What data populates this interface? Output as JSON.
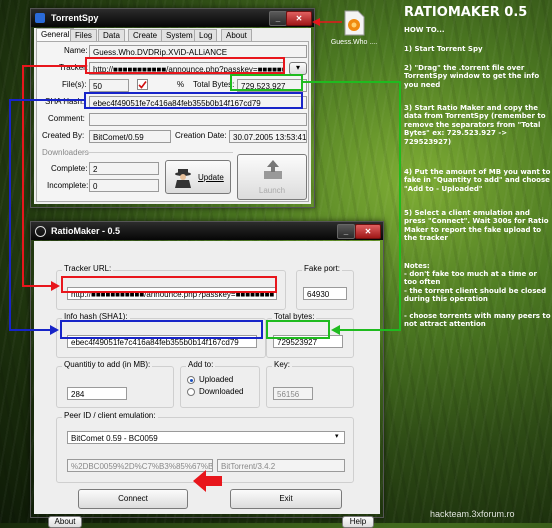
{
  "torrentspy": {
    "title": "TorrentSpy",
    "tabs": [
      "General",
      "Files",
      "Data",
      "Create",
      "System",
      "Log",
      "About"
    ],
    "name_label": "Name:",
    "name_value": "Guess.Who.DVDRip.XViD-ALLiANCE",
    "tracker_label": "Tracker:",
    "tracker_value": "http://■■■■■■■■■■■/announce.php?passkey=■■■■■■■",
    "files_label": "File(s):",
    "files_value": "50",
    "percent_label": "%",
    "total_bytes_label": "Total Bytes:",
    "total_bytes_value": "729.523.927",
    "sha_label": "SHA Hash:",
    "sha_value": "ebec4f49051fe7c416a84feb355b0b14f167cd79",
    "comment_label": "Comment:",
    "created_by_label": "Created By:",
    "created_by_value": "BitComet/0.59",
    "creation_date_label": "Creation Date:",
    "creation_date_value": "30.07.2005 13:53:41",
    "downloaders_label": "Downloaders",
    "complete_label": "Complete:",
    "complete_value": "2",
    "incomplete_label": "Incomplete:",
    "incomplete_value": "0",
    "update_label": "Update",
    "launch_label": "Launch"
  },
  "desktop_icon_label": "Guess.Who ....",
  "ratiomaker": {
    "title": "RatioMaker - 0.5",
    "tracker_url_label": "Tracker URL:",
    "tracker_url_value": "http://■■■■■■■■■■■/announce.php?passkey=■■■■■■■■",
    "fake_port_label": "Fake port:",
    "fake_port_value": "64930",
    "info_hash_label": "Info hash (SHA1):",
    "info_hash_value": "ebec4f49051fe7c416a84feb355b0b14f167cd79",
    "total_bytes_label": "Total bytes:",
    "total_bytes_value": "729523927",
    "quantity_label": "Quantitiy to add (in MB):",
    "quantity_value": "284",
    "add_to_label": "Add to:",
    "uploaded_label": "Uploaded",
    "downloaded_label": "Downloaded",
    "key_label": "Key:",
    "key_value": "56156",
    "peer_label": "Peer ID / client emulation:",
    "client_value": "BitComet 0.59 - BC0059",
    "peer_id_value": "%2DBC0059%2D%C7%B3%85%67%BD%",
    "agent_value": "BitTorrent/3.4.2",
    "connect_label": "Connect",
    "exit_label": "Exit",
    "about_label": "About",
    "help_label": "Help"
  },
  "instructions": {
    "heading": "RATIOMAKER 0.5",
    "howto": "HOW TO...",
    "step1": "1) Start Torrent Spy",
    "step2": "2) \"Drag\" the .torrent file over TorrentSpy window to get the info you need",
    "step3": "3) Start Ratio Maker and copy the data from TorrentSpy (remember to remove the separators from \"Total Bytes\" ex: 729.523.927  -> 729523927)",
    "step4": "4) Put the amount of MB you want to fake in \"Quantity to add\" and choose \"Add to - Uploaded\"",
    "step5": "5) Select a client emulation and press \"Connect\". Wait 300s for Ratio Maker to report the fake upload to the tracker",
    "notes_heading": "Notes:",
    "note1": "- don't fake too much at a time or too often",
    "note2": "- the torrent client should be closed during this operation",
    "note3": "- choose torrents with many peers to not attract attention"
  },
  "watermark": "hackteam.3xforum.ro",
  "colors": {
    "red": "#e8161c",
    "blue": "#1724c8",
    "green": "#1fbb1f"
  }
}
